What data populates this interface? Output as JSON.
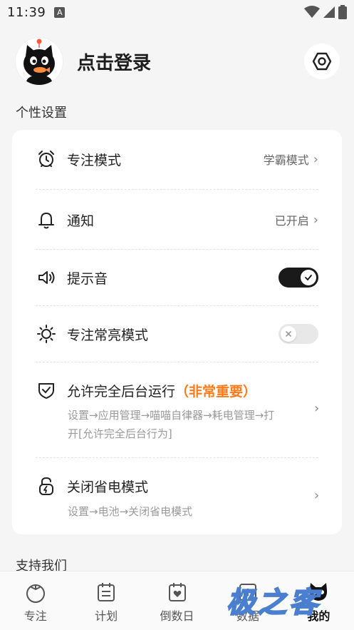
{
  "status_bar": {
    "time": "11:39",
    "notification_icon": "A"
  },
  "header": {
    "login_label": "点击登录"
  },
  "sections": {
    "personal_settings": "个性设置",
    "support_us": "支持我们"
  },
  "settings": {
    "focus_mode": {
      "label": "专注模式",
      "value": "学霸模式"
    },
    "notification": {
      "label": "通知",
      "value": "已开启"
    },
    "sound": {
      "label": "提示音",
      "enabled": true
    },
    "screen_on": {
      "label": "专注常亮模式",
      "enabled": false
    },
    "background": {
      "label": "允许完全后台运行",
      "important": "（非常重要）",
      "hint": "设置→应用管理→喵喵自律器→耗电管理→打开[允许完全后台行为]"
    },
    "battery": {
      "label": "关闭省电模式",
      "hint": "设置→电池→关闭省电模式"
    }
  },
  "bottom_nav": [
    {
      "label": "专注",
      "icon": "tomato-icon"
    },
    {
      "label": "计划",
      "icon": "calendar-list-icon"
    },
    {
      "label": "倒数日",
      "icon": "calendar-heart-icon"
    },
    {
      "label": "数据",
      "icon": "chart-icon"
    },
    {
      "label": "我的",
      "icon": "cat-icon"
    }
  ],
  "watermark": "极之客",
  "colors": {
    "accent_orange": "#ff7a1a",
    "toggle_on": "#1a1a1a",
    "background": "#f5f5f5"
  }
}
